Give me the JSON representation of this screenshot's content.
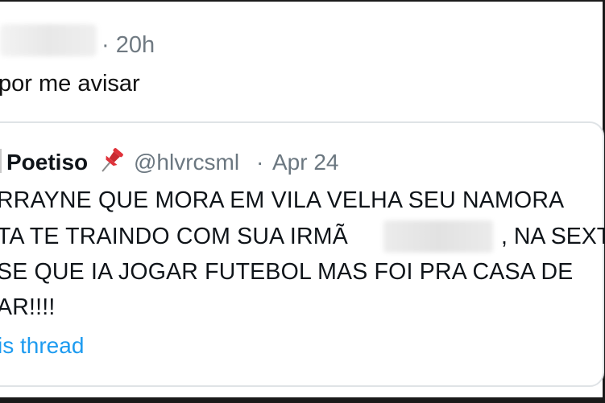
{
  "reply": {
    "time": "· 20h",
    "text": "por me avisar"
  },
  "quoted_tweet": {
    "name": "Poetiso",
    "handle": "@hlvrcsml",
    "separator": "·",
    "date": "Apr 24",
    "lines": [
      "RRAYNE QUE MORA EM VILA VELHA SEU NAMORA",
      "TA TE TRAINDO COM SUA IRMÃ",
      "SE QUE IA JOGAR FUTEBOL MAS FOI PRA CASA DE",
      "AR!!!!"
    ],
    "line2_after_blur": ", NA SEXT",
    "thread_link": "is thread"
  },
  "colors": {
    "link": "#1d9bf0",
    "secondary_text": "#6b7780",
    "pin": "#e0323a"
  },
  "icons": {
    "pin": "pushpin-icon"
  }
}
